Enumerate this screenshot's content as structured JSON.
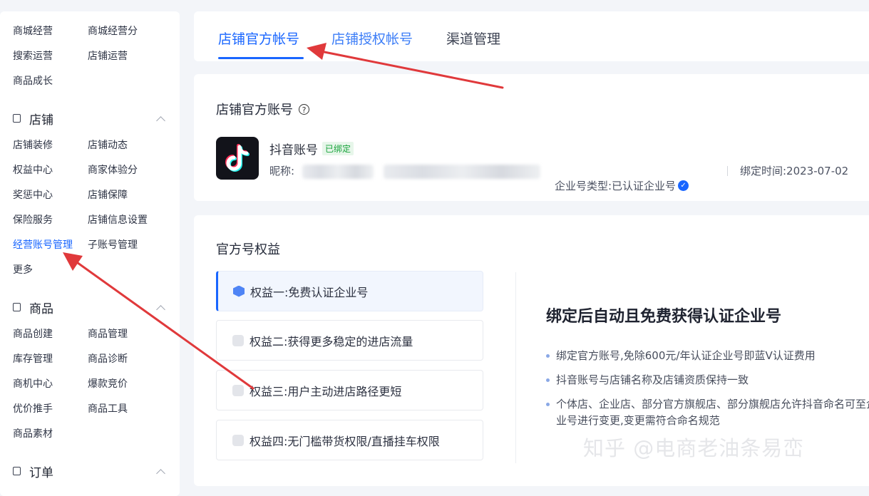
{
  "sidebar": {
    "top_items": [
      "商城经营",
      "商城经营分",
      "搜索运营",
      "店铺运营",
      "商品成长"
    ],
    "sections": [
      {
        "title": "店铺",
        "items": [
          "店铺装修",
          "店铺动态",
          "权益中心",
          "商家体验分",
          "奖惩中心",
          "店铺保障",
          "保险服务",
          "店铺信息设置",
          "经营账号管理",
          "子账号管理",
          "更多"
        ]
      },
      {
        "title": "商品",
        "items": [
          "商品创建",
          "商品管理",
          "库存管理",
          "商品诊断",
          "商机中心",
          "爆款竞价",
          "优价推手",
          "商品工具",
          "商品素材"
        ]
      },
      {
        "title": "订单",
        "items": []
      }
    ],
    "active_item": "经营账号管理"
  },
  "tabs": [
    "店铺官方帐号",
    "店铺授权帐号",
    "渠道管理"
  ],
  "account": {
    "section_title": "店铺官方账号",
    "help_glyph": "?",
    "name": "抖音账号",
    "bound_badge": "已绑定",
    "nickname_label": "昵称:",
    "type_text": "企业号类型:已认证企业号",
    "bind_time": "绑定时间:2023-07-02"
  },
  "benefits": {
    "title": "官方号权益",
    "items": [
      "权益一:免费认证企业号",
      "权益二:获得更多稳定的进店流量",
      "权益三:用户主动进店路径更短",
      "权益四:无门槛带货权限/直播挂车权限"
    ],
    "detail_title": "绑定后自动且免费获得认证企业号",
    "detail_points": [
      "绑定官方账号,免除600元/年认证企业号即蓝V认证费用",
      "抖音账号与店铺名称及店铺资质保持一致",
      "个体店、企业店、部分官方旗舰店、部分旗舰店允许抖音命名可至企业号进行变更,变更需符合命名规范"
    ]
  },
  "watermark": "知乎 @电商老油条易峦",
  "colors": {
    "accent": "#1966ff",
    "arrow": "#e0393b",
    "bound_green": "#17a33a"
  },
  "icons": {
    "verified": "✓",
    "tiktok": "tiktok-logo"
  }
}
